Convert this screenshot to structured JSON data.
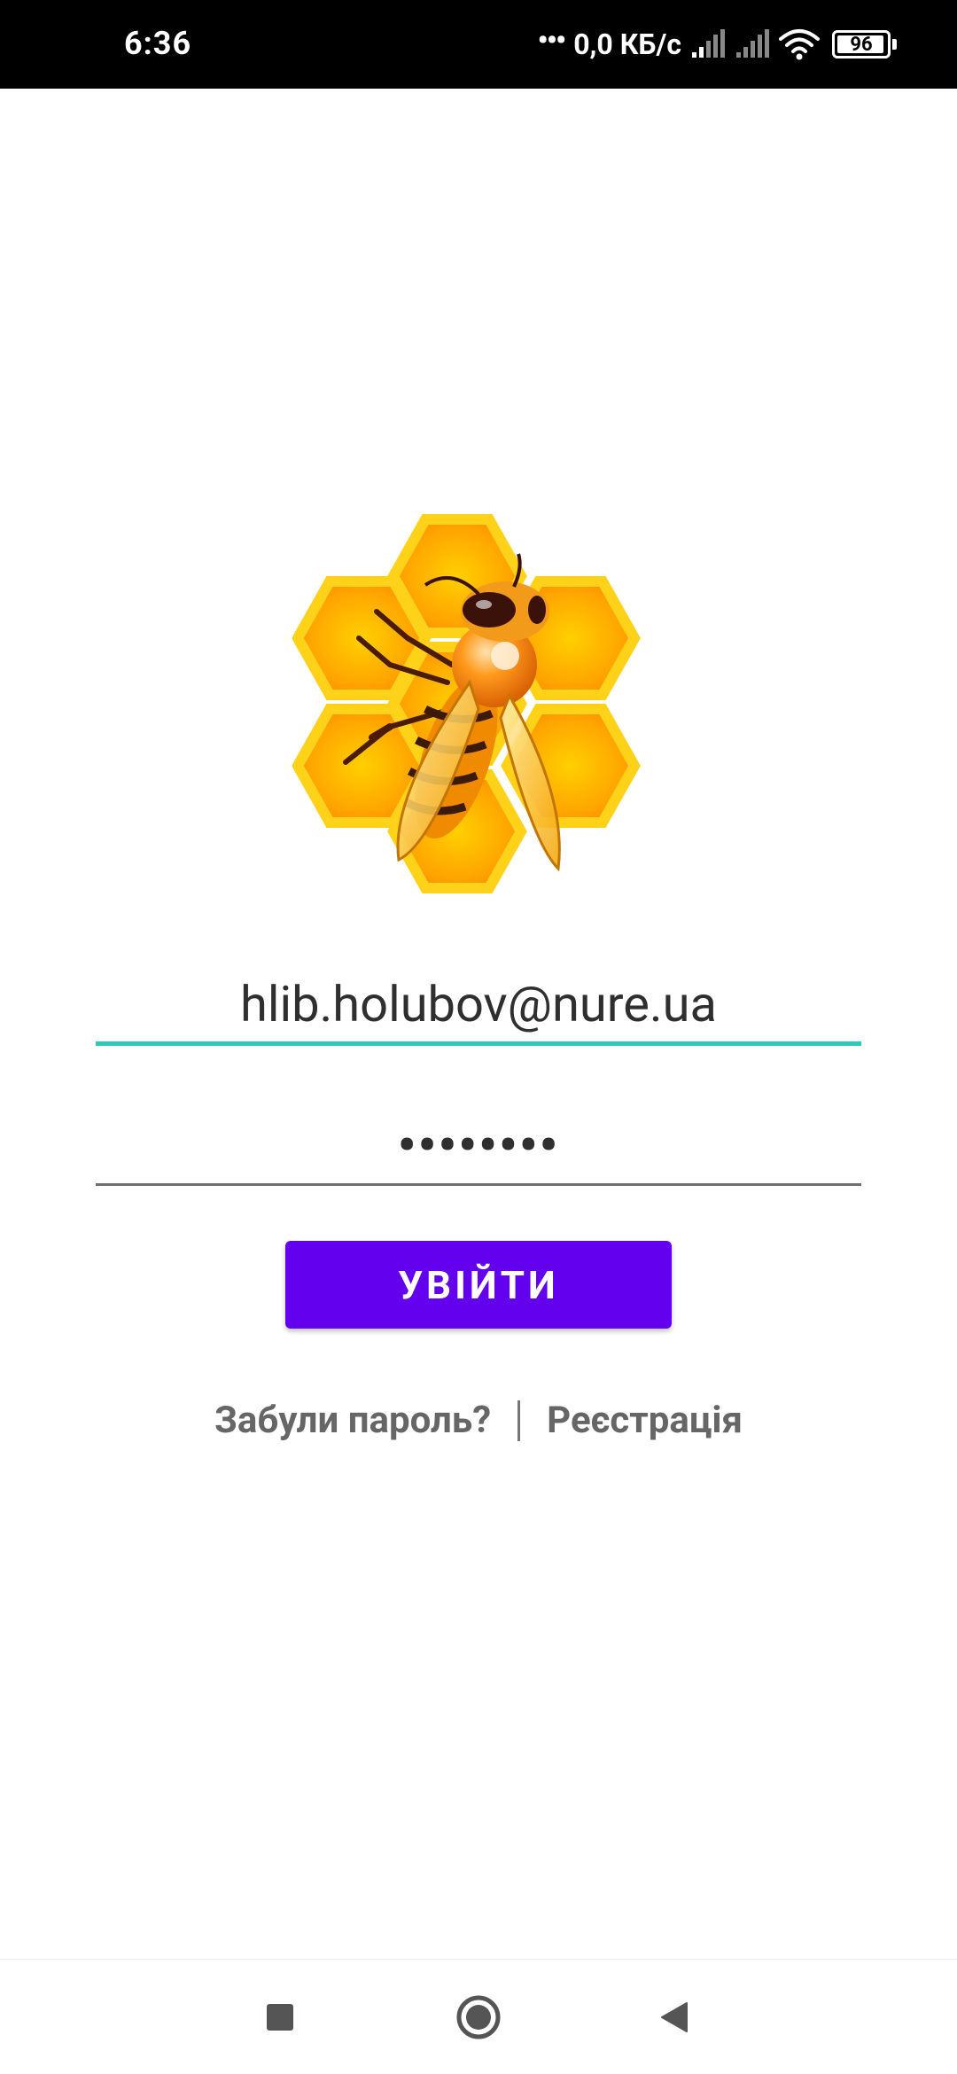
{
  "status_bar": {
    "time": "6:36",
    "network_speed": "0,0 КБ/с",
    "battery_level": "96",
    "battery_fraction": 0.96,
    "icons": [
      "more-dots-icon",
      "signal-icon",
      "signal-icon",
      "wifi-icon",
      "battery-icon"
    ]
  },
  "logo": {
    "icon": "bee-honeycomb-logo"
  },
  "login_form": {
    "email_value": "hlib.holubov@nure.ua",
    "password_value": "••••••••",
    "login_button_label": "УВІЙТИ",
    "forgot_password_label": "Забули пароль?",
    "register_label": "Реєстрація"
  },
  "colors": {
    "accent_underline": "#2ec9bb",
    "primary_button": "#6300ee",
    "link_text": "#666666"
  },
  "nav_bar": {
    "icons": [
      "recents-square-icon",
      "home-circle-icon",
      "back-triangle-icon"
    ]
  }
}
